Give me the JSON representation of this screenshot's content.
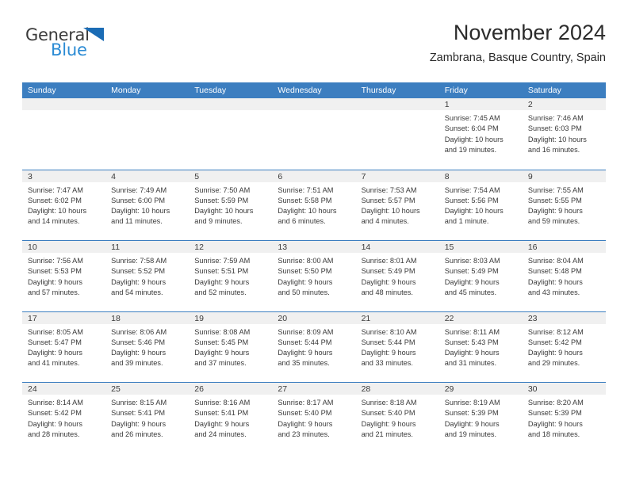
{
  "brand": {
    "name_part1": "General",
    "name_part2": "Blue",
    "triangle_color": "#1b6cb5",
    "blue_color": "#2b8bd4"
  },
  "header": {
    "title": "November 2024",
    "subtitle": "Zambrana, Basque Country, Spain"
  },
  "theme": {
    "header_row_bg": "#3c7ec0",
    "header_row_text": "#ffffff",
    "day_strip_bg": "#f0f0f0",
    "row_divider": "#3c7ec0",
    "body_text": "#3a3a3a"
  },
  "weekdays": [
    "Sunday",
    "Monday",
    "Tuesday",
    "Wednesday",
    "Thursday",
    "Friday",
    "Saturday"
  ],
  "weeks": [
    [
      {
        "day": "",
        "sunrise": "",
        "sunset": "",
        "daylight_line1": "",
        "daylight_line2": "",
        "empty": true
      },
      {
        "day": "",
        "sunrise": "",
        "sunset": "",
        "daylight_line1": "",
        "daylight_line2": "",
        "empty": true
      },
      {
        "day": "",
        "sunrise": "",
        "sunset": "",
        "daylight_line1": "",
        "daylight_line2": "",
        "empty": true
      },
      {
        "day": "",
        "sunrise": "",
        "sunset": "",
        "daylight_line1": "",
        "daylight_line2": "",
        "empty": true
      },
      {
        "day": "",
        "sunrise": "",
        "sunset": "",
        "daylight_line1": "",
        "daylight_line2": "",
        "empty": true
      },
      {
        "day": "1",
        "sunrise": "Sunrise: 7:45 AM",
        "sunset": "Sunset: 6:04 PM",
        "daylight_line1": "Daylight: 10 hours",
        "daylight_line2": "and 19 minutes.",
        "empty": false
      },
      {
        "day": "2",
        "sunrise": "Sunrise: 7:46 AM",
        "sunset": "Sunset: 6:03 PM",
        "daylight_line1": "Daylight: 10 hours",
        "daylight_line2": "and 16 minutes.",
        "empty": false
      }
    ],
    [
      {
        "day": "3",
        "sunrise": "Sunrise: 7:47 AM",
        "sunset": "Sunset: 6:02 PM",
        "daylight_line1": "Daylight: 10 hours",
        "daylight_line2": "and 14 minutes.",
        "empty": false
      },
      {
        "day": "4",
        "sunrise": "Sunrise: 7:49 AM",
        "sunset": "Sunset: 6:00 PM",
        "daylight_line1": "Daylight: 10 hours",
        "daylight_line2": "and 11 minutes.",
        "empty": false
      },
      {
        "day": "5",
        "sunrise": "Sunrise: 7:50 AM",
        "sunset": "Sunset: 5:59 PM",
        "daylight_line1": "Daylight: 10 hours",
        "daylight_line2": "and 9 minutes.",
        "empty": false
      },
      {
        "day": "6",
        "sunrise": "Sunrise: 7:51 AM",
        "sunset": "Sunset: 5:58 PM",
        "daylight_line1": "Daylight: 10 hours",
        "daylight_line2": "and 6 minutes.",
        "empty": false
      },
      {
        "day": "7",
        "sunrise": "Sunrise: 7:53 AM",
        "sunset": "Sunset: 5:57 PM",
        "daylight_line1": "Daylight: 10 hours",
        "daylight_line2": "and 4 minutes.",
        "empty": false
      },
      {
        "day": "8",
        "sunrise": "Sunrise: 7:54 AM",
        "sunset": "Sunset: 5:56 PM",
        "daylight_line1": "Daylight: 10 hours",
        "daylight_line2": "and 1 minute.",
        "empty": false
      },
      {
        "day": "9",
        "sunrise": "Sunrise: 7:55 AM",
        "sunset": "Sunset: 5:55 PM",
        "daylight_line1": "Daylight: 9 hours",
        "daylight_line2": "and 59 minutes.",
        "empty": false
      }
    ],
    [
      {
        "day": "10",
        "sunrise": "Sunrise: 7:56 AM",
        "sunset": "Sunset: 5:53 PM",
        "daylight_line1": "Daylight: 9 hours",
        "daylight_line2": "and 57 minutes.",
        "empty": false
      },
      {
        "day": "11",
        "sunrise": "Sunrise: 7:58 AM",
        "sunset": "Sunset: 5:52 PM",
        "daylight_line1": "Daylight: 9 hours",
        "daylight_line2": "and 54 minutes.",
        "empty": false
      },
      {
        "day": "12",
        "sunrise": "Sunrise: 7:59 AM",
        "sunset": "Sunset: 5:51 PM",
        "daylight_line1": "Daylight: 9 hours",
        "daylight_line2": "and 52 minutes.",
        "empty": false
      },
      {
        "day": "13",
        "sunrise": "Sunrise: 8:00 AM",
        "sunset": "Sunset: 5:50 PM",
        "daylight_line1": "Daylight: 9 hours",
        "daylight_line2": "and 50 minutes.",
        "empty": false
      },
      {
        "day": "14",
        "sunrise": "Sunrise: 8:01 AM",
        "sunset": "Sunset: 5:49 PM",
        "daylight_line1": "Daylight: 9 hours",
        "daylight_line2": "and 48 minutes.",
        "empty": false
      },
      {
        "day": "15",
        "sunrise": "Sunrise: 8:03 AM",
        "sunset": "Sunset: 5:49 PM",
        "daylight_line1": "Daylight: 9 hours",
        "daylight_line2": "and 45 minutes.",
        "empty": false
      },
      {
        "day": "16",
        "sunrise": "Sunrise: 8:04 AM",
        "sunset": "Sunset: 5:48 PM",
        "daylight_line1": "Daylight: 9 hours",
        "daylight_line2": "and 43 minutes.",
        "empty": false
      }
    ],
    [
      {
        "day": "17",
        "sunrise": "Sunrise: 8:05 AM",
        "sunset": "Sunset: 5:47 PM",
        "daylight_line1": "Daylight: 9 hours",
        "daylight_line2": "and 41 minutes.",
        "empty": false
      },
      {
        "day": "18",
        "sunrise": "Sunrise: 8:06 AM",
        "sunset": "Sunset: 5:46 PM",
        "daylight_line1": "Daylight: 9 hours",
        "daylight_line2": "and 39 minutes.",
        "empty": false
      },
      {
        "day": "19",
        "sunrise": "Sunrise: 8:08 AM",
        "sunset": "Sunset: 5:45 PM",
        "daylight_line1": "Daylight: 9 hours",
        "daylight_line2": "and 37 minutes.",
        "empty": false
      },
      {
        "day": "20",
        "sunrise": "Sunrise: 8:09 AM",
        "sunset": "Sunset: 5:44 PM",
        "daylight_line1": "Daylight: 9 hours",
        "daylight_line2": "and 35 minutes.",
        "empty": false
      },
      {
        "day": "21",
        "sunrise": "Sunrise: 8:10 AM",
        "sunset": "Sunset: 5:44 PM",
        "daylight_line1": "Daylight: 9 hours",
        "daylight_line2": "and 33 minutes.",
        "empty": false
      },
      {
        "day": "22",
        "sunrise": "Sunrise: 8:11 AM",
        "sunset": "Sunset: 5:43 PM",
        "daylight_line1": "Daylight: 9 hours",
        "daylight_line2": "and 31 minutes.",
        "empty": false
      },
      {
        "day": "23",
        "sunrise": "Sunrise: 8:12 AM",
        "sunset": "Sunset: 5:42 PM",
        "daylight_line1": "Daylight: 9 hours",
        "daylight_line2": "and 29 minutes.",
        "empty": false
      }
    ],
    [
      {
        "day": "24",
        "sunrise": "Sunrise: 8:14 AM",
        "sunset": "Sunset: 5:42 PM",
        "daylight_line1": "Daylight: 9 hours",
        "daylight_line2": "and 28 minutes.",
        "empty": false
      },
      {
        "day": "25",
        "sunrise": "Sunrise: 8:15 AM",
        "sunset": "Sunset: 5:41 PM",
        "daylight_line1": "Daylight: 9 hours",
        "daylight_line2": "and 26 minutes.",
        "empty": false
      },
      {
        "day": "26",
        "sunrise": "Sunrise: 8:16 AM",
        "sunset": "Sunset: 5:41 PM",
        "daylight_line1": "Daylight: 9 hours",
        "daylight_line2": "and 24 minutes.",
        "empty": false
      },
      {
        "day": "27",
        "sunrise": "Sunrise: 8:17 AM",
        "sunset": "Sunset: 5:40 PM",
        "daylight_line1": "Daylight: 9 hours",
        "daylight_line2": "and 23 minutes.",
        "empty": false
      },
      {
        "day": "28",
        "sunrise": "Sunrise: 8:18 AM",
        "sunset": "Sunset: 5:40 PM",
        "daylight_line1": "Daylight: 9 hours",
        "daylight_line2": "and 21 minutes.",
        "empty": false
      },
      {
        "day": "29",
        "sunrise": "Sunrise: 8:19 AM",
        "sunset": "Sunset: 5:39 PM",
        "daylight_line1": "Daylight: 9 hours",
        "daylight_line2": "and 19 minutes.",
        "empty": false
      },
      {
        "day": "30",
        "sunrise": "Sunrise: 8:20 AM",
        "sunset": "Sunset: 5:39 PM",
        "daylight_line1": "Daylight: 9 hours",
        "daylight_line2": "and 18 minutes.",
        "empty": false
      }
    ]
  ]
}
